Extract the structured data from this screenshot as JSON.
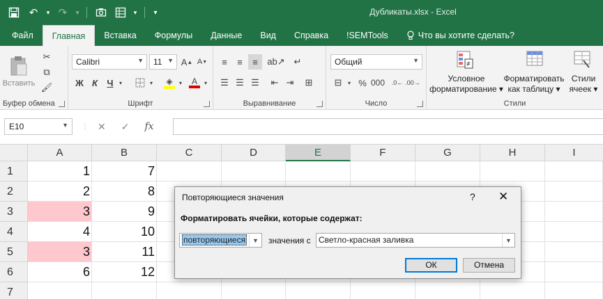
{
  "window": {
    "title": "Дубликаты.xlsx  -  Excel"
  },
  "tabs": [
    {
      "label": "Файл"
    },
    {
      "label": "Главная"
    },
    {
      "label": "Вставка"
    },
    {
      "label": "Формулы"
    },
    {
      "label": "Данные"
    },
    {
      "label": "Вид"
    },
    {
      "label": "Справка"
    },
    {
      "label": "!SEMTools"
    },
    {
      "label": "Что вы хотите сделать?"
    }
  ],
  "ribbon": {
    "clipboard": {
      "label": "Буфер обмена",
      "paste": "Вставить"
    },
    "font": {
      "label": "Шрифт",
      "name": "Calibri",
      "size": "11",
      "bold": "Ж",
      "italic": "К",
      "underline": "Ч"
    },
    "alignment": {
      "label": "Выравнивание"
    },
    "number": {
      "label": "Число",
      "format": "Общий"
    },
    "styles": {
      "label": "Стили",
      "conditional": [
        "Условное",
        "форматирование ▾"
      ],
      "as_table": [
        "Форматировать",
        "как таблицу ▾"
      ],
      "cell_styles": [
        "Стили",
        "ячеек ▾"
      ]
    }
  },
  "formula_bar": {
    "name_box": "E10",
    "fx": "fx",
    "value": ""
  },
  "grid": {
    "columns": [
      "A",
      "B",
      "C",
      "D",
      "E",
      "F",
      "G",
      "H",
      "I"
    ],
    "selected_column": "E",
    "rows": [
      {
        "n": "1",
        "a": "1",
        "b": "7"
      },
      {
        "n": "2",
        "a": "2",
        "b": "8"
      },
      {
        "n": "3",
        "a": "3",
        "b": "9"
      },
      {
        "n": "4",
        "a": "4",
        "b": "10"
      },
      {
        "n": "5",
        "a": "3",
        "b": "11"
      },
      {
        "n": "6",
        "a": "6",
        "b": "12"
      },
      {
        "n": "7",
        "a": "",
        "b": ""
      }
    ],
    "highlight_color": "#ffc7ce"
  },
  "dialog": {
    "title": "Повторяющиеся значения",
    "help": "?",
    "close": "✕",
    "prompt": "Форматировать ячейки, которые содержат:",
    "type_value": "повторяющиеся",
    "with_label": "значения с",
    "format_value": "Светло-красная заливка",
    "ok": "ОК",
    "cancel": "Отмена"
  },
  "colors": {
    "excel_green": "#217346",
    "ribbon_bg": "#f3f3f3"
  }
}
